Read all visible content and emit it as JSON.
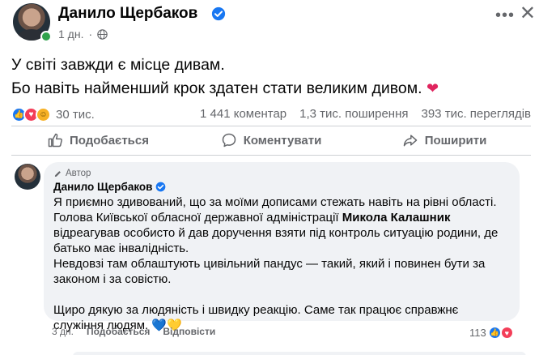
{
  "post": {
    "author": "Данило Щербаков",
    "time": "1 дн.",
    "more_icon": "more-horizontal-icon",
    "close_icon": "close-icon",
    "lines": [
      "У світі завжди є місце дивам.",
      "Бо навіть найменший крок здатен стати великим дивом."
    ],
    "heart": "❤"
  },
  "stats": {
    "reactions_count": "30 тис.",
    "comments": "1 441 коментар",
    "shares": "1,3 тис. поширення",
    "views": "393 тис. переглядів"
  },
  "actions": {
    "like": "Подобається",
    "comment": "Коментувати",
    "share": "Поширити"
  },
  "comment": {
    "author_tag": "Автор",
    "author": "Данило Щербаков",
    "p1": "Я приємно здивований, що за моїми дописами стежать навіть на рівні області.",
    "p2_before": "Голова Київської обласної державної адміністрації ",
    "p2_bold": "Микола Калашник",
    "p2_after": " відреагував особисто й дав доручення взяти під контроль ситуацію родини, де батько має інвалідність.",
    "p3": "Невдовзі там облаштують цивільний пандус — такий, який і повинен бути за законом і за совістю.",
    "p4": "Щиро дякую за людяність і швидку реакцію. Саме так працює справжнє служіння людям. 💙💛",
    "time": "3 дн.",
    "like": "Подобається",
    "reply": "Відповісти",
    "reactions_count": "113"
  },
  "colors": {
    "accent": "#1877f2",
    "secondary_text": "#65676b",
    "bubble": "#f0f2f5",
    "online": "#31a24c",
    "love": "#f33e58"
  }
}
